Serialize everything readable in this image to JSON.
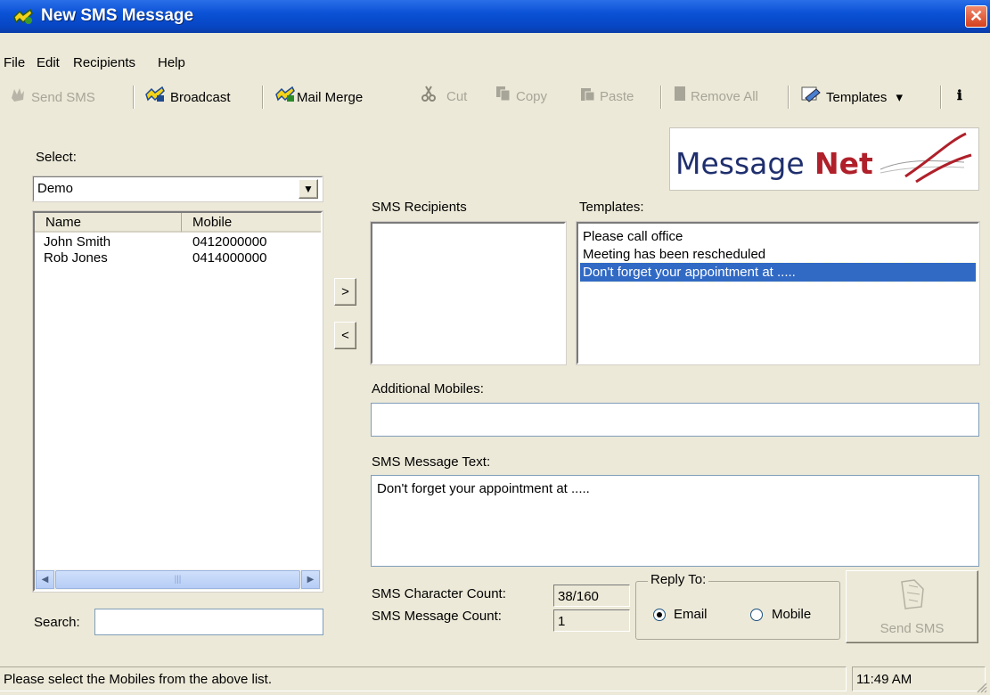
{
  "window": {
    "title": "New SMS Message",
    "close_glyph": "✕"
  },
  "menu": [
    "File",
    "Edit",
    "Recipients",
    "Help"
  ],
  "toolbar": {
    "send_sms": "Send SMS",
    "broadcast": "Broadcast",
    "mail_merge": "Mail Merge",
    "cut": "Cut",
    "copy": "Copy",
    "paste": "Paste",
    "remove_all": "Remove All",
    "templates": "Templates",
    "dropdown_glyph": "▾",
    "help_glyph": "ℹ"
  },
  "logo": {
    "part1": "Message",
    "part2": "Net",
    "color1": "#1f2f6e",
    "color2": "#b0202a"
  },
  "select": {
    "label": "Select:",
    "value": "Demo",
    "arrow_glyph": "▼"
  },
  "contacts": {
    "columns": [
      "Name",
      "Mobile"
    ],
    "rows": [
      {
        "name": "John Smith",
        "mobile": "0412000000"
      },
      {
        "name": "Rob Jones",
        "mobile": "0414000000"
      }
    ],
    "scroll_left_glyph": "◀",
    "scroll_right_glyph": "▶",
    "thumb_grip": "|||"
  },
  "search": {
    "label": "Search:",
    "value": ""
  },
  "move": {
    "add": ">",
    "remove": "<"
  },
  "recipients": {
    "label": "SMS Recipients"
  },
  "templates_list": {
    "label": "Templates:",
    "items": [
      "Please call office",
      "Meeting has been rescheduled",
      "Don't forget your appointment at ....."
    ],
    "selected_index": 2
  },
  "additional": {
    "label": "Additional Mobiles:",
    "value": ""
  },
  "message": {
    "label": "SMS Message Text:",
    "value": "Don't forget your appointment at ....."
  },
  "counts": {
    "char_label": "SMS Character Count:",
    "char_value": "38/160",
    "msg_label": "SMS Message Count:",
    "msg_value": "1"
  },
  "reply": {
    "legend": "Reply To:",
    "email": "Email",
    "mobile": "Mobile",
    "selected": "Email"
  },
  "send_button": {
    "label": "Send SMS"
  },
  "status": {
    "text": "Please select the Mobiles from the above list.",
    "time": "11:49 AM"
  },
  "colors": {
    "selection": "#316ac5",
    "titlebar": "#0a52d6",
    "face": "#ece9d8"
  }
}
